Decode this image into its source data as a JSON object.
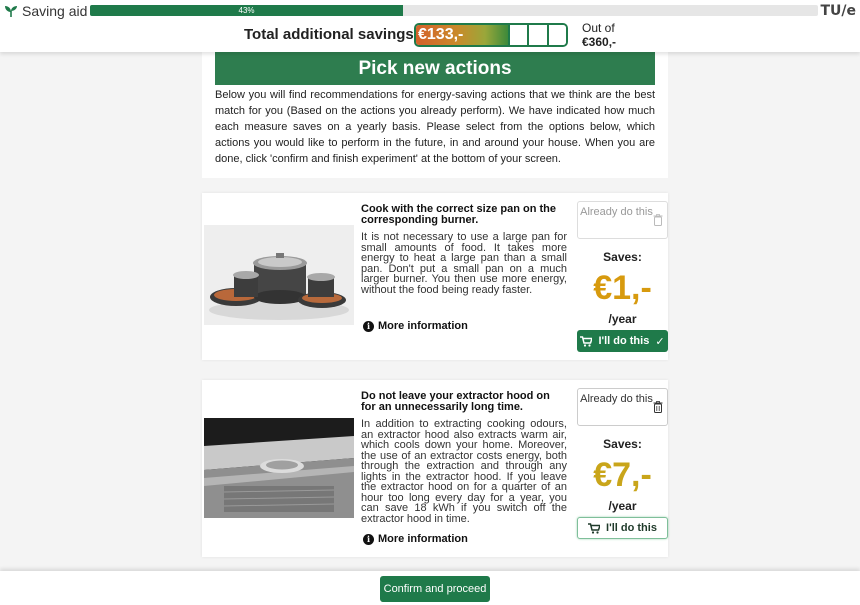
{
  "header": {
    "app_name": "Saving aid",
    "progress_text": "43%",
    "progress_fraction": 0.43,
    "logo_text": "TU/e",
    "savings_label": "Total additional savings:",
    "savings_value": "€133,-",
    "out_of_label": "Out of",
    "out_of_value": "€360,-",
    "colors": {
      "primary_green": "#1f7a4a",
      "amount_gold": "#d79a0e"
    }
  },
  "intro": {
    "title": "Pick new actions",
    "text": "Below you will find recommendations for energy-saving actions that we think are the best match for you (Based on the actions you already perform). We have indicated how much each measure saves on a yearly basis. Please select from the options below, which actions you would like to perform in the future, in and around your house. When you are done, click 'confirm and finish experiment' at the bottom of your screen."
  },
  "actions": [
    {
      "title": "Cook with the correct size pan on the corresponding burner.",
      "description": "It is not necessary to use a large pan for small amounts of food. It takes more energy to heat a large pan than a small pan. Don't put a small pan on a much larger burner. You then use more energy, without the food being ready faster.",
      "more_info": "More information",
      "already_label": "Already do this",
      "saves_label": "Saves:",
      "amount": "€1,-",
      "per_year": "/year",
      "do_label": "I'll do this",
      "do_check": "✓",
      "image_icon": "cookware-photo"
    },
    {
      "title": "Do not leave your extractor hood on for an unnecessarily long time.",
      "description": "In addition to extracting cooking odours, an extractor hood also extracts warm air, which cools down your home. Moreover, the use of an extractor costs energy, both through the extraction and through any lights in the extractor hood. If you leave the extractor hood on for a quarter of an hour too long every day for a year, you can save 18 kWh if you switch off the extractor hood in time.",
      "more_info": "More information",
      "already_label": "Already do this",
      "saves_label": "Saves:",
      "amount": "€7,-",
      "per_year": "/year",
      "do_label": "I'll do this",
      "image_icon": "extractor-hood-photo"
    }
  ],
  "footer": {
    "confirm_label": "Confirm and proceed"
  }
}
